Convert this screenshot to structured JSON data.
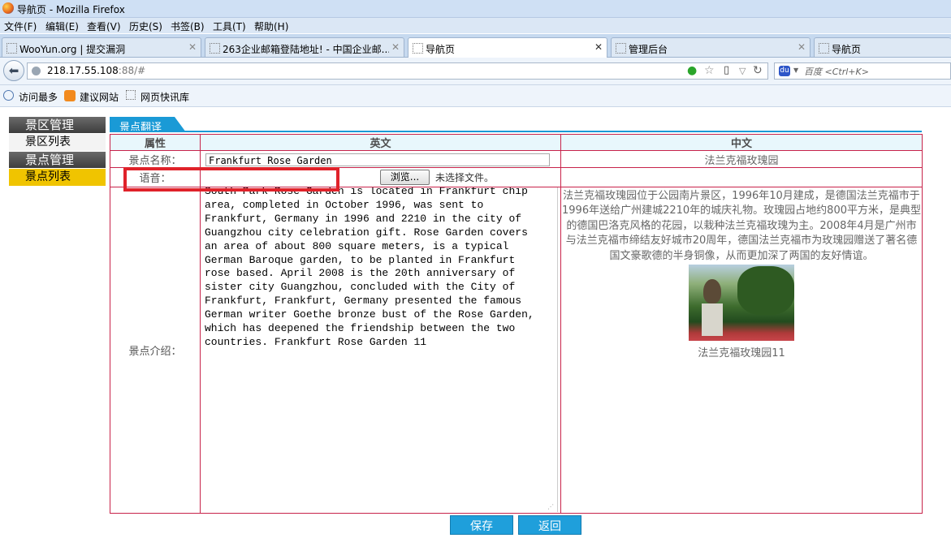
{
  "window": {
    "title": "导航页 - Mozilla Firefox"
  },
  "menu": [
    "文件(F)",
    "编辑(E)",
    "查看(V)",
    "历史(S)",
    "书签(B)",
    "工具(T)",
    "帮助(H)"
  ],
  "tabs": [
    {
      "label": "WooYun.org | 提交漏洞"
    },
    {
      "label": "263企业邮箱登陆地址! - 中国企业邮..."
    },
    {
      "label": "导航页"
    },
    {
      "label": "管理后台"
    },
    {
      "label": "导航页"
    }
  ],
  "url": {
    "host": "218.17.55.108",
    "rest": ":88/#"
  },
  "search": {
    "placeholder": "百度 <Ctrl+K>"
  },
  "bookmarks": [
    "访问最多",
    "建议网站",
    "网页快讯库"
  ],
  "sidebar": {
    "sections": [
      {
        "title": "景区管理",
        "items": [
          "景区列表"
        ]
      },
      {
        "title": "景点管理",
        "items": [
          "景点列表"
        ]
      }
    ]
  },
  "panel": {
    "title": "景点翻译"
  },
  "table": {
    "headers": [
      "属性",
      "英文",
      "中文"
    ],
    "name_label": "景点名称：",
    "name_en": "Frankfurt Rose Garden",
    "name_zh": "法兰克福玫瑰园",
    "audio_label": "语音：",
    "browse_label": "浏览...",
    "no_file": "未选择文件。",
    "intro_label": "景点介绍：",
    "intro_en": "South Park Rose Garden is located in Frankfurt chip area, completed in October 1996, was sent to Frankfurt, Germany in 1996 and 2210 in the city of Guangzhou city celebration gift. Rose Garden covers an area of about 800 square meters, is a typical German Baroque garden, to be planted in Frankfurt rose based. April 2008 is the 20th anniversary of sister city Guangzhou, concluded with the City of Frankfurt, Frankfurt, Germany presented the famous German writer Goethe bronze bust of the Rose Garden, which has deepened the friendship between the two countries. Frankfurt Rose Garden 11",
    "intro_zh": "法兰克福玫瑰园位于公园南片景区，1996年10月建成，是德国法兰克福市于1996年送给广州建城2210年的城庆礼物。玫瑰园占地约800平方米，是典型的德国巴洛克风格的花园，以栽种法兰克福玫瑰为主。2008年4月是广州市与法兰克福市缔结友好城市20周年，德国法兰克福市为玫瑰园赠送了著名德国文豪歌德的半身铜像，从而更加深了两国的友好情谊。",
    "photo_caption": "法兰克福玫瑰园11"
  },
  "buttons": {
    "save": "保存",
    "back": "返回"
  }
}
